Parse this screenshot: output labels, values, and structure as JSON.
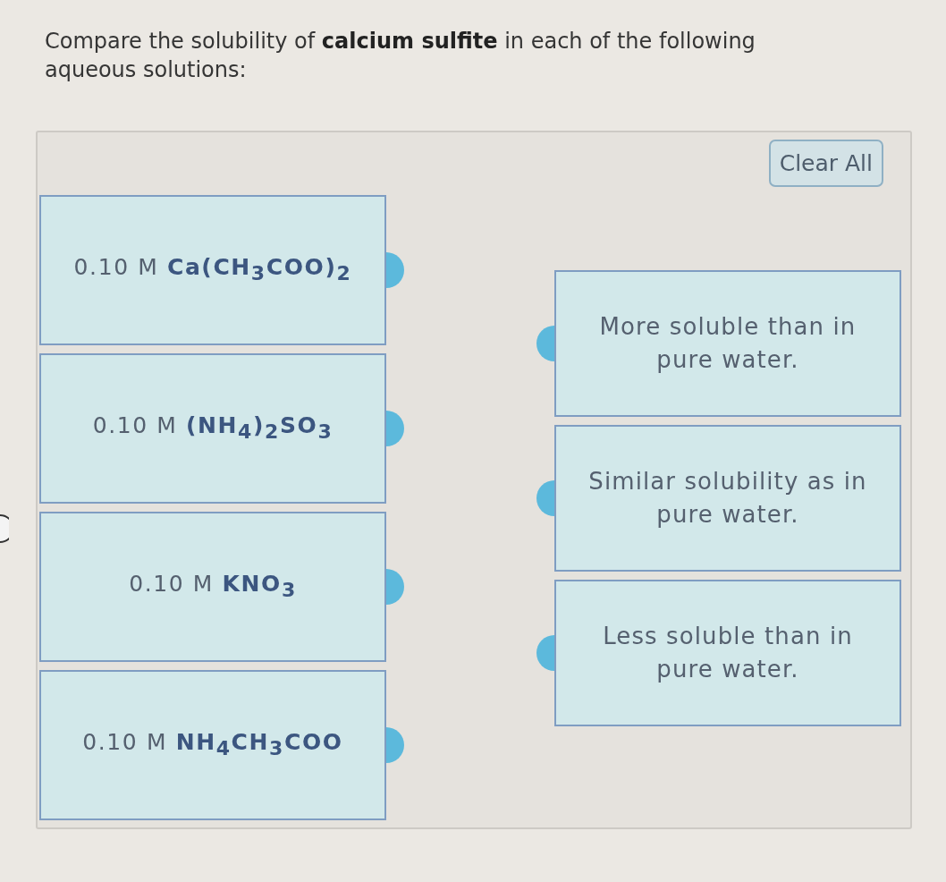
{
  "question": "Compare the solubility of **calcium sulfite** in each of the following aqueous solutions:",
  "clear_button": "Clear All",
  "solutions": [
    {
      "text": "0.10 M **Ca(CH$_{3}$COO)$_{2}$**"
    },
    {
      "text": "0.10 M **(NH$_{4}$)$_{2}$SO$_{3}$**"
    },
    {
      "text": "0.10 M **KNO$_{3}$**"
    },
    {
      "text": "0.10 M **NH$_{4}$CH$_{3}$COO**"
    }
  ],
  "categories": [
    {
      "text": "More soluble than in pure water."
    },
    {
      "text": "Similar solubility as in pure water."
    },
    {
      "text": "Less soluble than in pure water."
    }
  ]
}
